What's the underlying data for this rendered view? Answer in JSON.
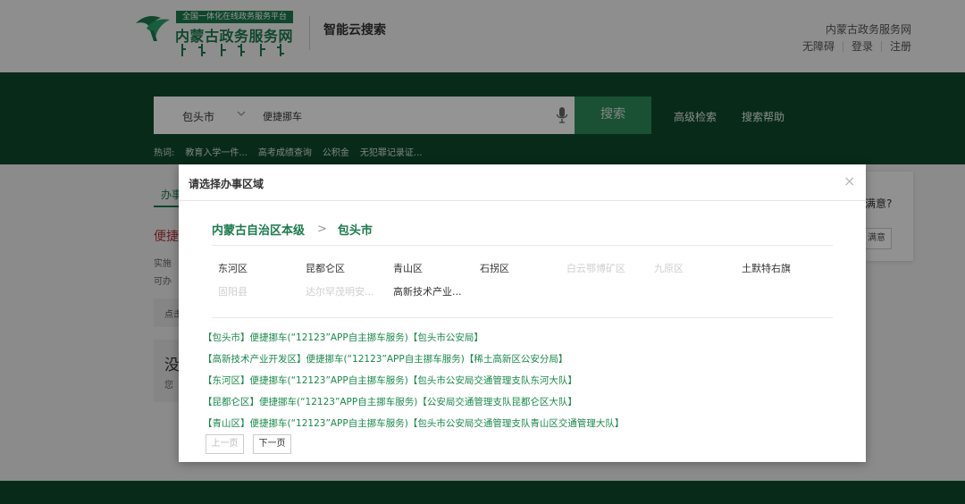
{
  "header": {
    "logo_badge": "全国一体化在线政务服务平台",
    "logo_title": "内蒙古政务服务网",
    "search_brand": "智能云搜索",
    "site_name": "内蒙古政务服务网",
    "links": {
      "accessibility": "无障碍",
      "login": "登录",
      "register": "注册"
    }
  },
  "search": {
    "region": "包头市",
    "query": "便捷挪车",
    "button": "搜索",
    "advanced": "高级检索",
    "help": "搜索帮助"
  },
  "hot": {
    "label": "热词:",
    "items": [
      "教育入学一件...",
      "高考成绩查询",
      "公积金",
      "无犯罪记录证..."
    ]
  },
  "background": {
    "tab": "办事",
    "result_title": "便捷",
    "line1": "实施",
    "line2": "可办",
    "box": "点击",
    "notfound_big": "没",
    "notfound_small": "您",
    "feedback_question": "满意?",
    "feedback_button": "满意"
  },
  "modal": {
    "title": "请选择办事区域",
    "close": "×",
    "breadcrumb": {
      "level1": "内蒙古自治区本级",
      "arrow": ">",
      "level2": "包头市"
    },
    "districts": [
      {
        "name": "东河区",
        "enabled": true
      },
      {
        "name": "昆都仑区",
        "enabled": true
      },
      {
        "name": "青山区",
        "enabled": true
      },
      {
        "name": "石拐区",
        "enabled": true
      },
      {
        "name": "白云鄂博矿区",
        "enabled": false
      },
      {
        "name": "九原区",
        "enabled": false
      },
      {
        "name": "土默特右旗",
        "enabled": true
      },
      {
        "name": "固阳县",
        "enabled": false
      },
      {
        "name": "达尔罕茂明安...",
        "enabled": false
      },
      {
        "name": "高新技术产业...",
        "enabled": true
      }
    ],
    "results": [
      "【包头市】便捷挪车(“12123”APP自主挪车服务)【包头市公安局】",
      "【高新技术产业开发区】便捷挪车(“12123”APP自主挪车服务)【稀土高新区公安分局】",
      "【东河区】便捷挪车(“12123”APP自主挪车服务)【包头市公安局交通管理支队东河大队】",
      "【昆都仑区】便捷挪车(“12123”APP自主挪车服务)【公安局交通管理支队昆都仑区大队】",
      "【青山区】便捷挪车(“12123”APP自主挪车服务)【包头市公安局交通管理支队青山区交通管理大队】"
    ],
    "pager": {
      "prev": "上一页",
      "next": "下一页"
    }
  },
  "colors": {
    "brand_green": "#1a7a4c",
    "band_green": "#0e4a2b",
    "search_button": "#2e8c5a",
    "link_green": "#1a8a4a",
    "accent_red": "#b4323a"
  },
  "icons": [
    "logo-emblem-icon",
    "mongolian-script-icon",
    "chevron-down-icon",
    "microphone-icon",
    "close-icon"
  ]
}
